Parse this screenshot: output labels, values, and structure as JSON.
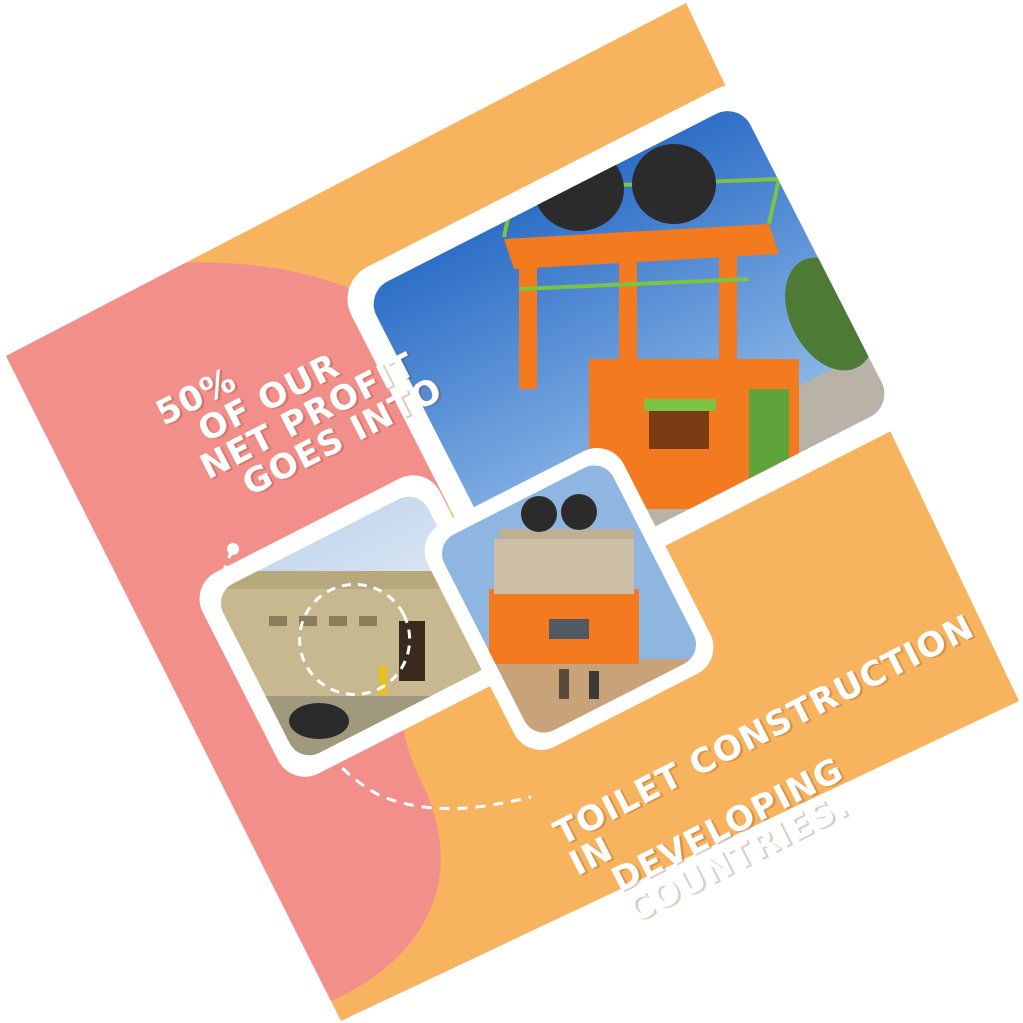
{
  "headline": {
    "percent": "50%",
    "line1": "OF OUR",
    "line2": "NET PROFIT",
    "line3": "GOES INTO"
  },
  "caption": {
    "line1": "TOILET CONSTRUCTION IN",
    "line2": "DEVELOPING COUNTRIES."
  },
  "colors": {
    "background_orange": "#f7b35e",
    "blob_pink": "#f38f8a",
    "frame_white": "#ffffff",
    "building_orange": "#f47a1f",
    "sky_blue": "#3f7fd1",
    "railing_green": "#7cc243",
    "door_green": "#5fa33b",
    "tank_black": "#2b2b2b"
  },
  "photos": [
    {
      "name": "main-photo",
      "icon": "completed-toilet-building-image"
    },
    {
      "name": "before-photo",
      "icon": "unfinished-building-image"
    },
    {
      "name": "progress-photo",
      "icon": "construction-progress-image"
    }
  ]
}
